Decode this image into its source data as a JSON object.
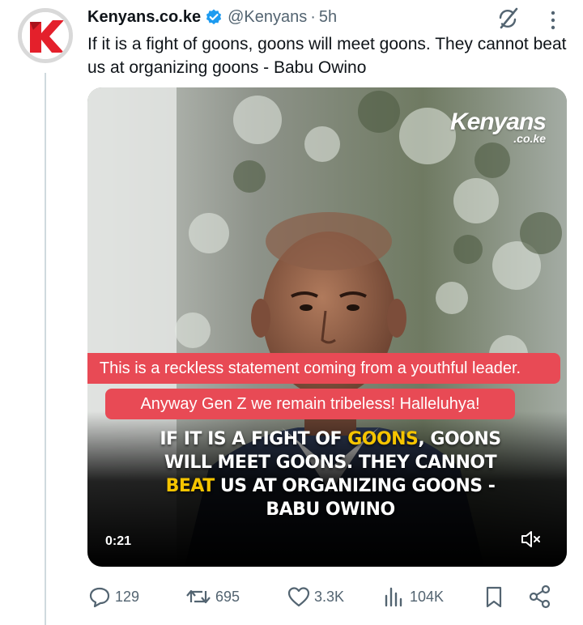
{
  "tweet": {
    "author_name": "Kenyans.co.ke",
    "handle": "@Kenyans",
    "separator": "·",
    "time": "5h",
    "avatar_letter": "K",
    "text": "If it is a fight of goons, goons will meet goons. They cannot beat us at organizing goons - Babu Owino"
  },
  "media": {
    "logo_line1": "Kenyans",
    "logo_line2": ".co.ke",
    "overlay_note_line1": "This is a reckless statement coming from a youthful leader.",
    "overlay_note_line2": "Anyway Gen Z we remain tribeless! Halleluhya!",
    "caption": {
      "l1_a": "IF IT IS A FIGHT OF ",
      "l1_hl": "GOONS",
      "l1_b": ", GOONS",
      "l2": "WILL MEET GOONS. THEY CANNOT",
      "l3_hl": "BEAT",
      "l3_b": " US AT ORGANIZING GOONS -",
      "l4": "BABU OWINO"
    },
    "duration": "0:21"
  },
  "actions": {
    "replies": "129",
    "reposts": "695",
    "likes": "3.3K",
    "views": "104K"
  },
  "colors": {
    "brand_red": "#e4202b",
    "verified_blue": "#1d9bf0",
    "note_red": "#e84a55",
    "caption_yellow": "#f5c400",
    "muted_text": "#536471"
  },
  "icons": [
    "verified-badge-icon",
    "grok-icon",
    "more-icon",
    "mute-icon",
    "reply-icon",
    "repost-icon",
    "like-icon",
    "views-icon",
    "bookmark-icon",
    "share-icon"
  ]
}
